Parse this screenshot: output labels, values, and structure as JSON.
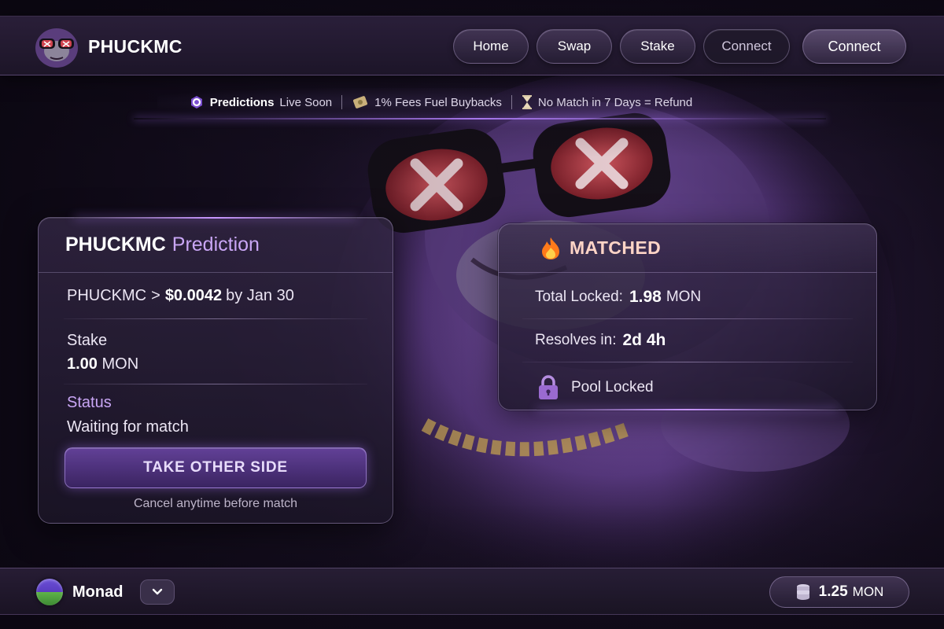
{
  "brand": {
    "name": "PHUCKMC",
    "avatar_icon": "gorilla-avatar-icon"
  },
  "nav": {
    "home": "Home",
    "swap": "Swap",
    "stake": "Stake",
    "connect_outline": "Connect",
    "connect_main": "Connect"
  },
  "announcement": {
    "item1_bold": "Predictions",
    "item1_rest": "Live Soon",
    "item1_icon": "prediction-logo-icon",
    "item2": "1% Fees Fuel Buybacks",
    "item2_icon": "money-icon",
    "item3": "No Match in 7 Days = Refund",
    "item3_icon": "hourglass-icon"
  },
  "prediction": {
    "title_bold": "PHUCKMC",
    "title_accent": "Prediction",
    "target_token": "PHUCKMC",
    "target_op": ">",
    "target_price": "$0.0042",
    "target_by": "by Jan 30",
    "stake_label": "Stake",
    "stake_amount": "1.00",
    "stake_unit": "MON",
    "status_label": "Status",
    "status_value": "Waiting for match",
    "take_side_label": "TAKE OTHER SIDE",
    "cancel_note": "Cancel anytime before match"
  },
  "matched": {
    "icon": "fire-icon",
    "title": "MATCHED",
    "total_locked_label": "Total Locked:",
    "total_locked_amount": "1.98",
    "total_locked_unit": "MON",
    "resolves_label": "Resolves in:",
    "resolves_value": "2d 4h",
    "pool_icon": "padlock-icon",
    "pool_status": "Pool Locked"
  },
  "footer": {
    "chain_name": "Monad",
    "balance_amount": "1.25",
    "balance_unit": "MON",
    "balance_icon": "coin-stack-icon"
  },
  "colors": {
    "accent_purple": "#c9a6f5",
    "matched_text": "#ffd4c6",
    "background": "#120c1c"
  }
}
